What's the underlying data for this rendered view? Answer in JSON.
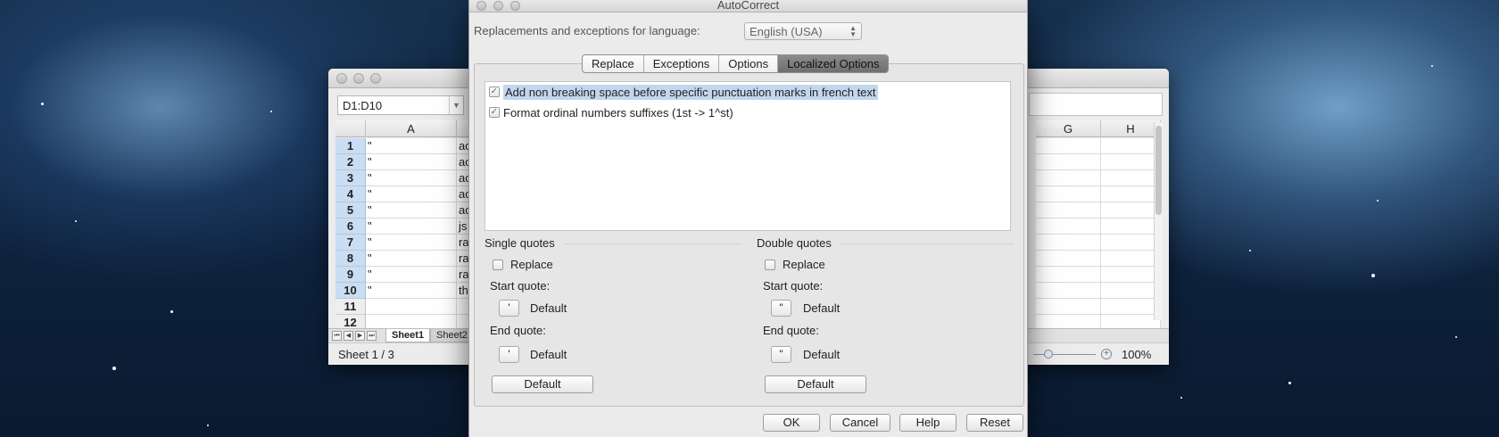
{
  "spreadsheet": {
    "name_box": "D1:D10",
    "columns": [
      "A",
      "G",
      "H"
    ],
    "rows": [
      {
        "num": "1",
        "a": "\"",
        "b": "ac"
      },
      {
        "num": "2",
        "a": "\"",
        "b": "ac"
      },
      {
        "num": "3",
        "a": "\"",
        "b": "ac"
      },
      {
        "num": "4",
        "a": "\"",
        "b": "ac"
      },
      {
        "num": "5",
        "a": "\"",
        "b": "ac"
      },
      {
        "num": "6",
        "a": "\"",
        "b": "js"
      },
      {
        "num": "7",
        "a": "\"",
        "b": "ra"
      },
      {
        "num": "8",
        "a": "\"",
        "b": "ra"
      },
      {
        "num": "9",
        "a": "\"",
        "b": "ra"
      },
      {
        "num": "10",
        "a": "\"",
        "b": "th"
      },
      {
        "num": "11",
        "a": "",
        "b": ""
      },
      {
        "num": "12",
        "a": "",
        "b": ""
      }
    ],
    "sheet_tabs": [
      "Sheet1",
      "Sheet2"
    ],
    "status": "Sheet 1 / 3",
    "zoom": "100%"
  },
  "dialog": {
    "title": "AutoCorrect",
    "language_label": "Replacements and exceptions for language:",
    "language_value": "English (USA)",
    "tabs": [
      "Replace",
      "Exceptions",
      "Options",
      "Localized Options"
    ],
    "active_tab": "Localized Options",
    "options": [
      {
        "label": "Add non breaking space before specific punctuation marks in french text",
        "checked": true
      },
      {
        "label": "Format ordinal numbers suffixes (1st -> 1^st)",
        "checked": true
      }
    ],
    "single": {
      "title": "Single quotes",
      "replace": "Replace",
      "start_label": "Start quote:",
      "start_char": "'",
      "start_default": "Default",
      "end_label": "End quote:",
      "end_char": "'",
      "end_default": "Default",
      "default_button": "Default"
    },
    "double": {
      "title": "Double quotes",
      "replace": "Replace",
      "start_label": "Start quote:",
      "start_char": "\"",
      "start_default": "Default",
      "end_label": "End quote:",
      "end_char": "\"",
      "end_default": "Default",
      "default_button": "Default"
    },
    "buttons": {
      "ok": "OK",
      "cancel": "Cancel",
      "help": "Help",
      "reset": "Reset"
    }
  }
}
